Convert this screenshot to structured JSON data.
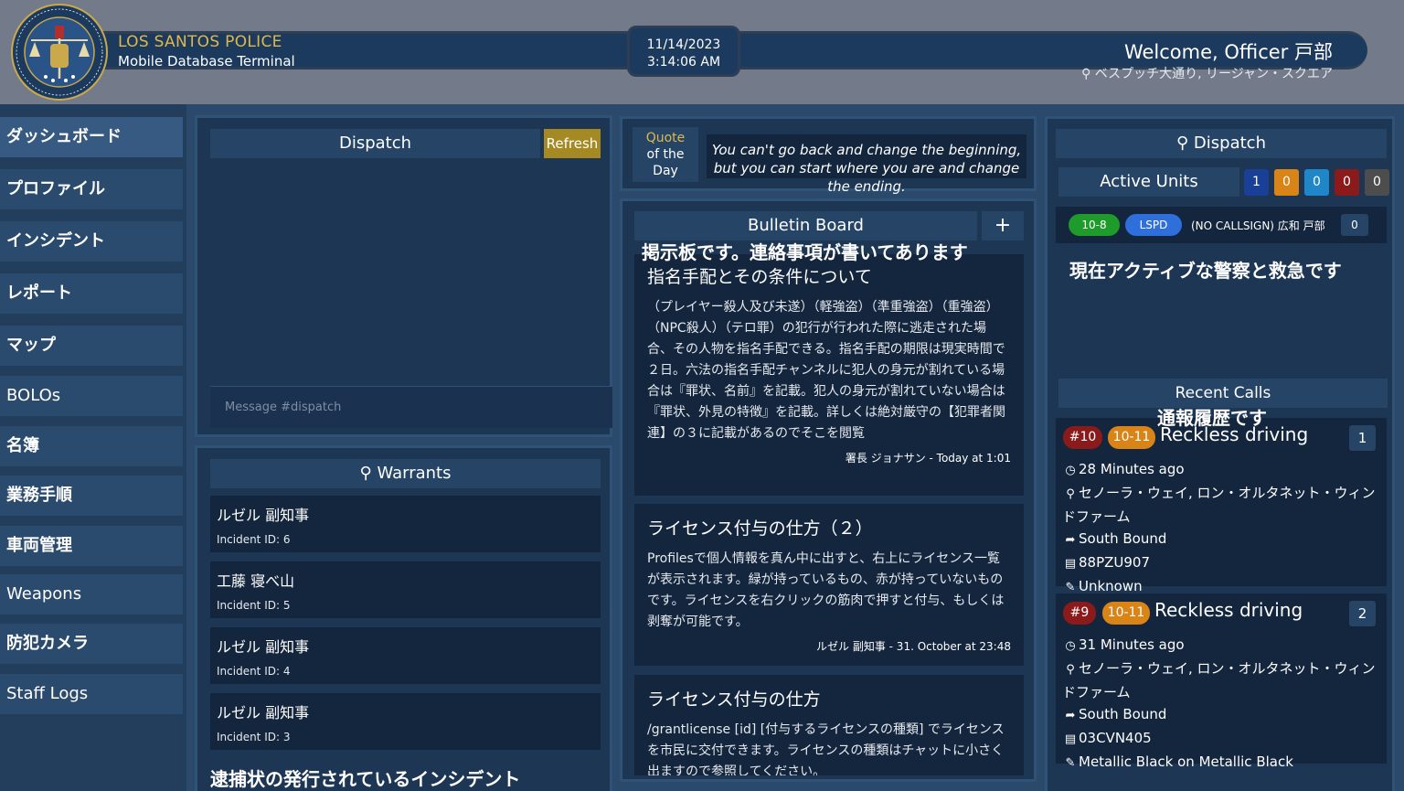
{
  "header": {
    "org_name": "LOS SANTOS POLICE",
    "org_sub": "Mobile Database Terminal",
    "date": "11/14/2023",
    "time": "3:14:06 AM",
    "welcome": "Welcome, Officer 戸部",
    "location": "ベスプッチ大通り, リージャン・スクエア"
  },
  "sidebar": {
    "items": [
      {
        "label": "ダッシュボード"
      },
      {
        "label": "プロファイル"
      },
      {
        "label": "インシデント"
      },
      {
        "label": "レポート"
      },
      {
        "label": "マップ"
      },
      {
        "label": "BOLOs"
      },
      {
        "label": "名簿"
      },
      {
        "label": "業務手順"
      },
      {
        "label": "車両管理"
      },
      {
        "label": "Weapons"
      },
      {
        "label": "防犯カメラ"
      },
      {
        "label": "Staff Logs"
      }
    ]
  },
  "dispatch": {
    "title": "Dispatch",
    "refresh_label": "Refresh",
    "message_placeholder": "Message #dispatch"
  },
  "warrants": {
    "title": "Warrants",
    "items": [
      {
        "name": "ルゼル 副知事",
        "incident": "Incident ID: 6"
      },
      {
        "name": "工藤 寝べ山",
        "incident": "Incident ID: 5"
      },
      {
        "name": "ルゼル 副知事",
        "incident": "Incident ID: 4"
      },
      {
        "name": "ルゼル 副知事",
        "incident": "Incident ID: 3"
      }
    ],
    "caption": "逮捕状の発行されているインシデント"
  },
  "quote": {
    "label_line1": "Quote",
    "label_line2": "of the",
    "label_line3": "Day",
    "text": "You can't go back and change the beginning, but you can start where you are and change the ending."
  },
  "bulletin": {
    "title": "Bulletin Board",
    "add_label": "+",
    "caption": "掲示板です。連絡事項が書いてあります",
    "posts": [
      {
        "title": "指名手配とその条件について",
        "body": "（プレイヤー殺人及び未遂）（軽強盗）（準重強盗）（重強盗）（NPC殺人）（テロ罪）の犯行が行われた際に逃走された場合、その人物を指名手配できる。指名手配の期限は現実時間で２日。六法の指名手配チャンネルに犯人の身元が割れている場合は『罪状、名前』を記載。犯人の身元が割れていない場合は『罪状、外見の特徴』を記載。詳しくは絶対厳守の【犯罪者関連】の３に記載があるのでそこを閲覧",
        "meta": "署長 ジョナサン - Today at 1:01"
      },
      {
        "title": "ライセンス付与の仕方（２）",
        "body": "Profilesで個人情報を真ん中に出すと、右上にライセンス一覧が表示されます。緑が持っているもの、赤が持っていないものです。ライセンスを右クリックの筋肉で押すと付与、もしくは剥奪が可能です。",
        "meta": "ルゼル 副知事 - 31. October at 23:48"
      },
      {
        "title": "ライセンス付与の仕方",
        "body": "/grantlicense [id] [付与するライセンスの種類] でライセンスを市民に交付できます。ライセンスの種類はチャットに小さく出ますので参照してください。"
      }
    ]
  },
  "units": {
    "title": "Dispatch",
    "active_units_label": "Active Units",
    "counts": [
      {
        "value": "1",
        "color": "#1a3f96"
      },
      {
        "value": "0",
        "color": "#d88417"
      },
      {
        "value": "0",
        "color": "#1f86c8"
      },
      {
        "value": "0",
        "color": "#8b1a1a"
      },
      {
        "value": "0",
        "color": "#4d4d4d"
      }
    ],
    "unit": {
      "status": "10-8",
      "status_color": "#1f9b2b",
      "dept": "LSPD",
      "dept_color": "#2f6fdc",
      "name": "(NO CALLSIGN) 広和 戸部",
      "count": "0"
    },
    "caption": "現在アクティブな警察と救急です"
  },
  "recent_calls": {
    "title": "Recent Calls",
    "caption": "通報履歴です",
    "calls": [
      {
        "id": "#10",
        "code": "10-11",
        "title": "Reckless driving",
        "number": "1",
        "time": "28 Minutes ago",
        "location": "セノーラ・ウェイ, ロン・オルタネット・ウィンドファーム",
        "direction": "South Bound",
        "plate": "88PZU907",
        "vehicle": "Unknown"
      },
      {
        "id": "#9",
        "code": "10-11",
        "title": "Reckless driving",
        "number": "2",
        "time": "31 Minutes ago",
        "location": "セノーラ・ウェイ, ロン・オルタネット・ウィンドファーム",
        "direction": "South Bound",
        "plate": "03CVN405",
        "vehicle": "Metallic Black on Metallic Black"
      }
    ]
  },
  "colors": {
    "accent_gold": "#e0b84a",
    "panel": "#1d3654",
    "card": "#14263d",
    "background": "#2b4a6b"
  }
}
